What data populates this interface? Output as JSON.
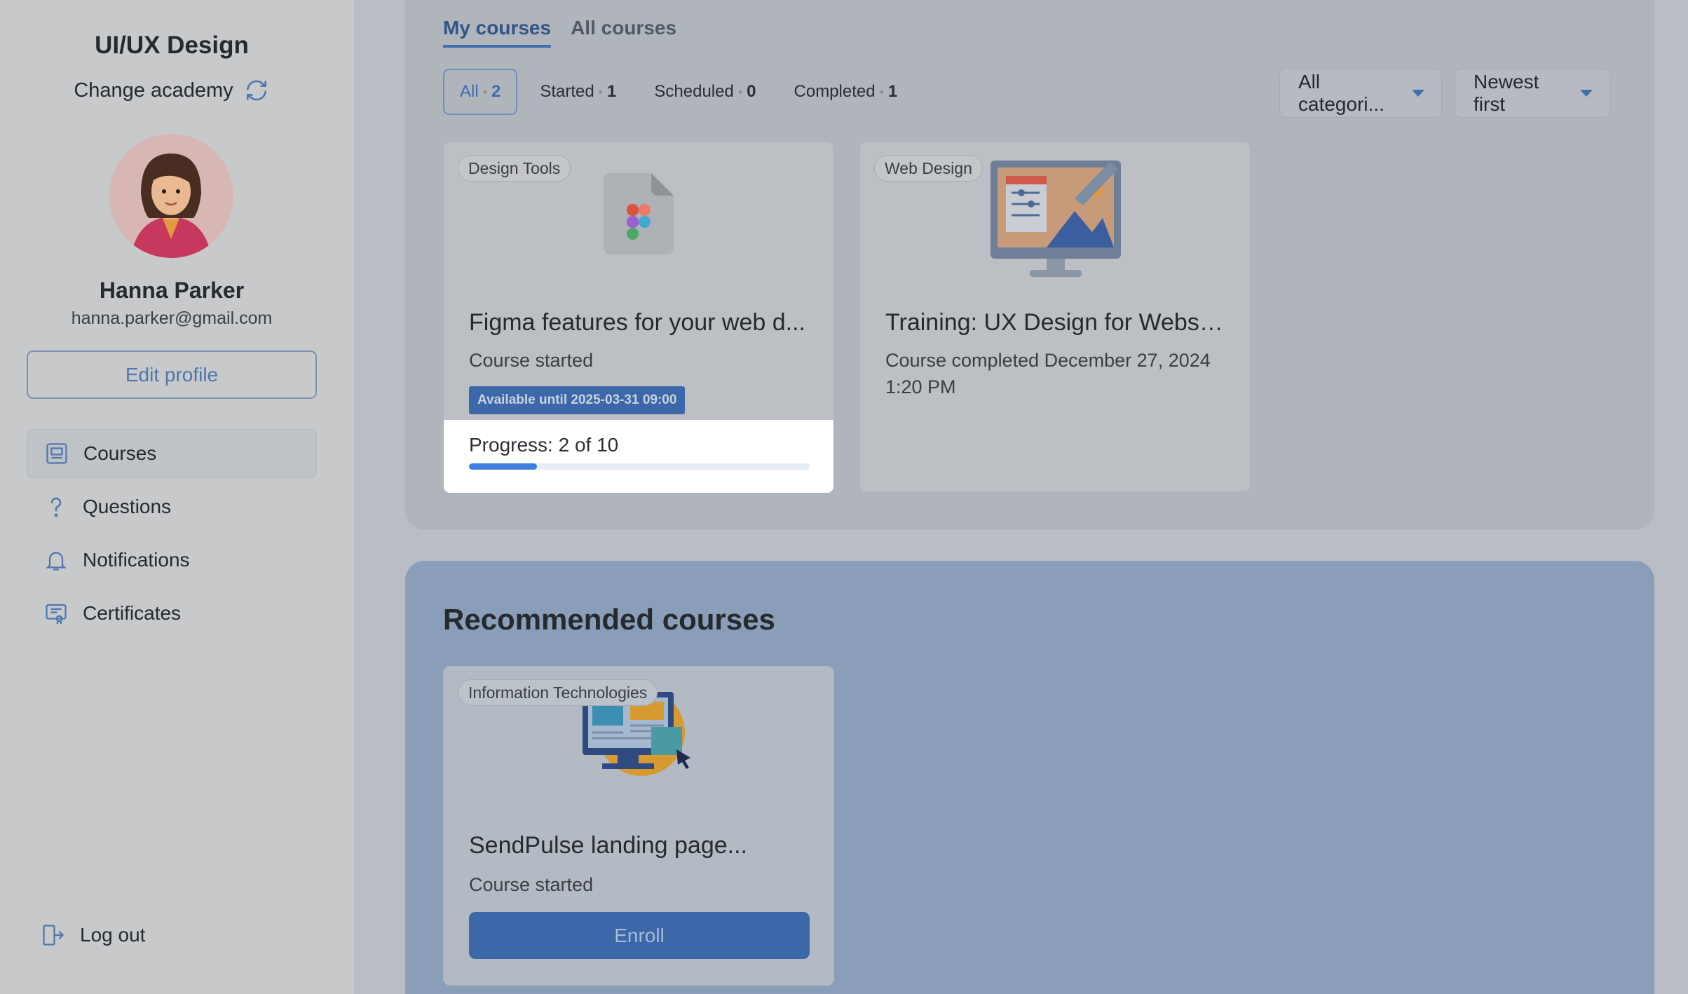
{
  "sidebar": {
    "academy_title": "UI/UX Design",
    "change_academy": "Change academy",
    "user_name": "Hanna Parker",
    "user_email": "hanna.parker@gmail.com",
    "edit_profile": "Edit profile",
    "nav": [
      {
        "label": "Courses",
        "icon": "courses-icon",
        "active": true
      },
      {
        "label": "Questions",
        "icon": "question-icon",
        "active": false
      },
      {
        "label": "Notifications",
        "icon": "bell-icon",
        "active": false
      },
      {
        "label": "Certificates",
        "icon": "certificate-icon",
        "active": false
      }
    ],
    "logout": "Log out"
  },
  "tabs": {
    "my_courses": "My courses",
    "all_courses": "All courses"
  },
  "filters": {
    "all": {
      "label": "All",
      "count": "2"
    },
    "started": {
      "label": "Started",
      "count": "1"
    },
    "scheduled": {
      "label": "Scheduled",
      "count": "0"
    },
    "completed": {
      "label": "Completed",
      "count": "1"
    },
    "dot": "•"
  },
  "selects": {
    "category": "All categori...",
    "sort": "Newest first"
  },
  "courses": [
    {
      "category": "Design Tools",
      "title": "Figma features for your web d...",
      "status": "Course started",
      "availability": "Available until 2025-03-31 09:00",
      "progress_label": "Progress: 2 of 10",
      "progress_fraction": 0.2
    },
    {
      "category": "Web Design",
      "title": "Training: UX Design for Websit...",
      "status": "Course completed December 27, 2024 1:20 PM"
    }
  ],
  "recommended": {
    "heading": "Recommended courses",
    "courses": [
      {
        "category": "Information Technologies",
        "title": "SendPulse landing page...",
        "status": "Course started",
        "button": "Enroll"
      }
    ]
  },
  "colors": {
    "accent": "#3c67a8",
    "progress": "#3f7ee0"
  }
}
